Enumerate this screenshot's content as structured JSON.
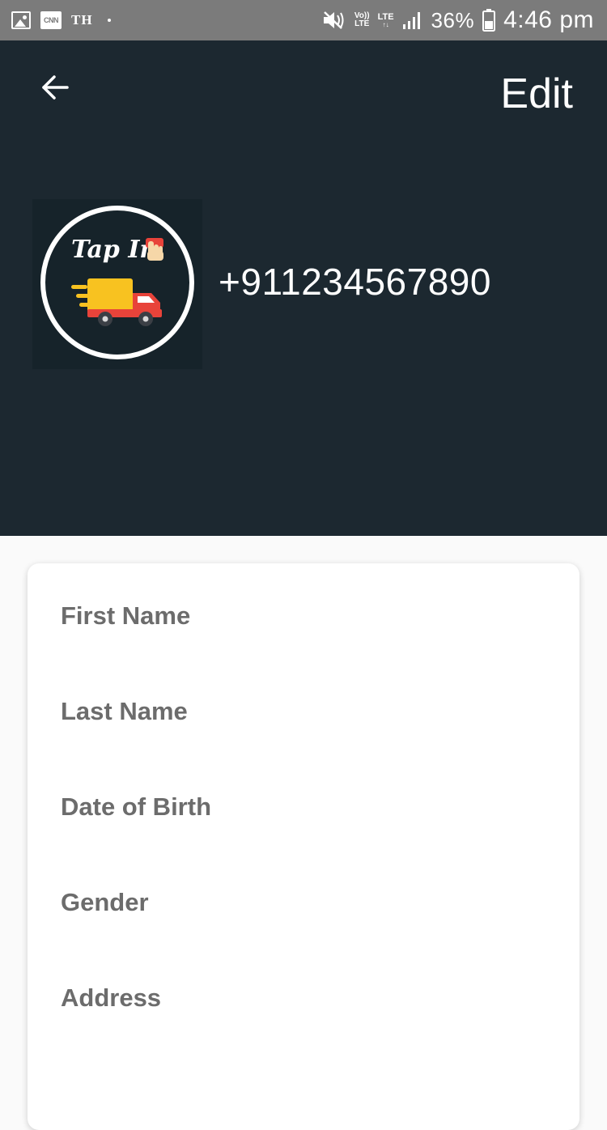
{
  "status_bar": {
    "carrier_text": "TH",
    "cnn_text": "CNN",
    "volte_top": "Vo))",
    "volte_bottom": "LTE",
    "lte_label": "LTE",
    "lte_arrows": "↑↓",
    "battery_percent": "36%",
    "time": "4:46 pm",
    "icons": [
      "image-icon",
      "cnn-icon",
      "mute-icon",
      "volte-icon",
      "lte-icon",
      "signal-icon",
      "battery-icon"
    ]
  },
  "header": {
    "back_icon": "arrow-left-icon",
    "edit_label": "Edit",
    "phone": "+911234567890",
    "logo": {
      "text": "Tap In",
      "icons": [
        "hand-icon",
        "truck-icon"
      ],
      "colors": {
        "circle_bg": "#16232a",
        "ring": "#ffffff",
        "truck_cargo": "#f8c220",
        "truck_cab": "#e8433a"
      }
    },
    "background_color": "#1c2830"
  },
  "form": {
    "fields": [
      {
        "key": "first_name",
        "label": "First Name",
        "value": ""
      },
      {
        "key": "last_name",
        "label": "Last Name",
        "value": ""
      },
      {
        "key": "date_of_birth",
        "label": "Date of Birth",
        "value": ""
      },
      {
        "key": "gender",
        "label": "Gender",
        "value": ""
      },
      {
        "key": "address",
        "label": "Address",
        "value": ""
      }
    ]
  }
}
